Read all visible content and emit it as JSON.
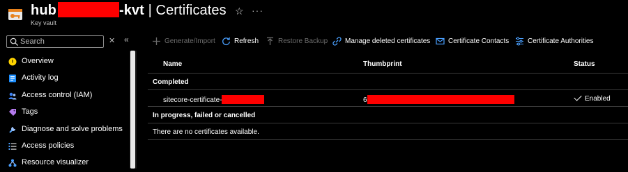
{
  "header": {
    "title_prefix": "hub",
    "title_suffix": "-kvt",
    "title_separator": " | ",
    "page_title": "Certificates",
    "subtitle": "Key vault",
    "star_glyph": "☆",
    "more_glyph": "···"
  },
  "sidebar": {
    "search_placeholder": "Search",
    "clear_glyph": "✕",
    "collapse_glyph": "«",
    "items": [
      {
        "label": "Overview",
        "icon": "overview-icon",
        "color": "#ffd400"
      },
      {
        "label": "Activity log",
        "icon": "activity-log-icon",
        "color": "#1e90ff"
      },
      {
        "label": "Access control (IAM)",
        "icon": "iam-icon",
        "color": "#3b82f6"
      },
      {
        "label": "Tags",
        "icon": "tag-icon",
        "color": "#b57bee"
      },
      {
        "label": "Diagnose and solve problems",
        "icon": "diagnose-icon",
        "color": "#5aa9ff"
      },
      {
        "label": "Access policies",
        "icon": "access-policies-icon",
        "color": "#4aa0ff"
      },
      {
        "label": "Resource visualizer",
        "icon": "resource-visualizer-icon",
        "color": "#4aa0ff"
      }
    ]
  },
  "toolbar": {
    "generate_import": "Generate/Import",
    "refresh": "Refresh",
    "restore_backup": "Restore Backup",
    "manage_deleted": "Manage deleted certificates",
    "certificate_contacts": "Certificate Contacts",
    "certificate_authorities": "Certificate Authorities"
  },
  "table": {
    "columns": {
      "name": "Name",
      "thumbprint": "Thumbprint",
      "status": "Status"
    },
    "group_completed": "Completed",
    "rows": [
      {
        "name_prefix": "sitecore-certificate-",
        "thumbprint_prefix": "6",
        "status": "Enabled"
      }
    ],
    "group_in_progress": "In progress, failed or cancelled",
    "empty_message": "There are no certificates available."
  },
  "colors": {
    "accent": "#4aa0ff",
    "redaction": "#fe0000"
  }
}
